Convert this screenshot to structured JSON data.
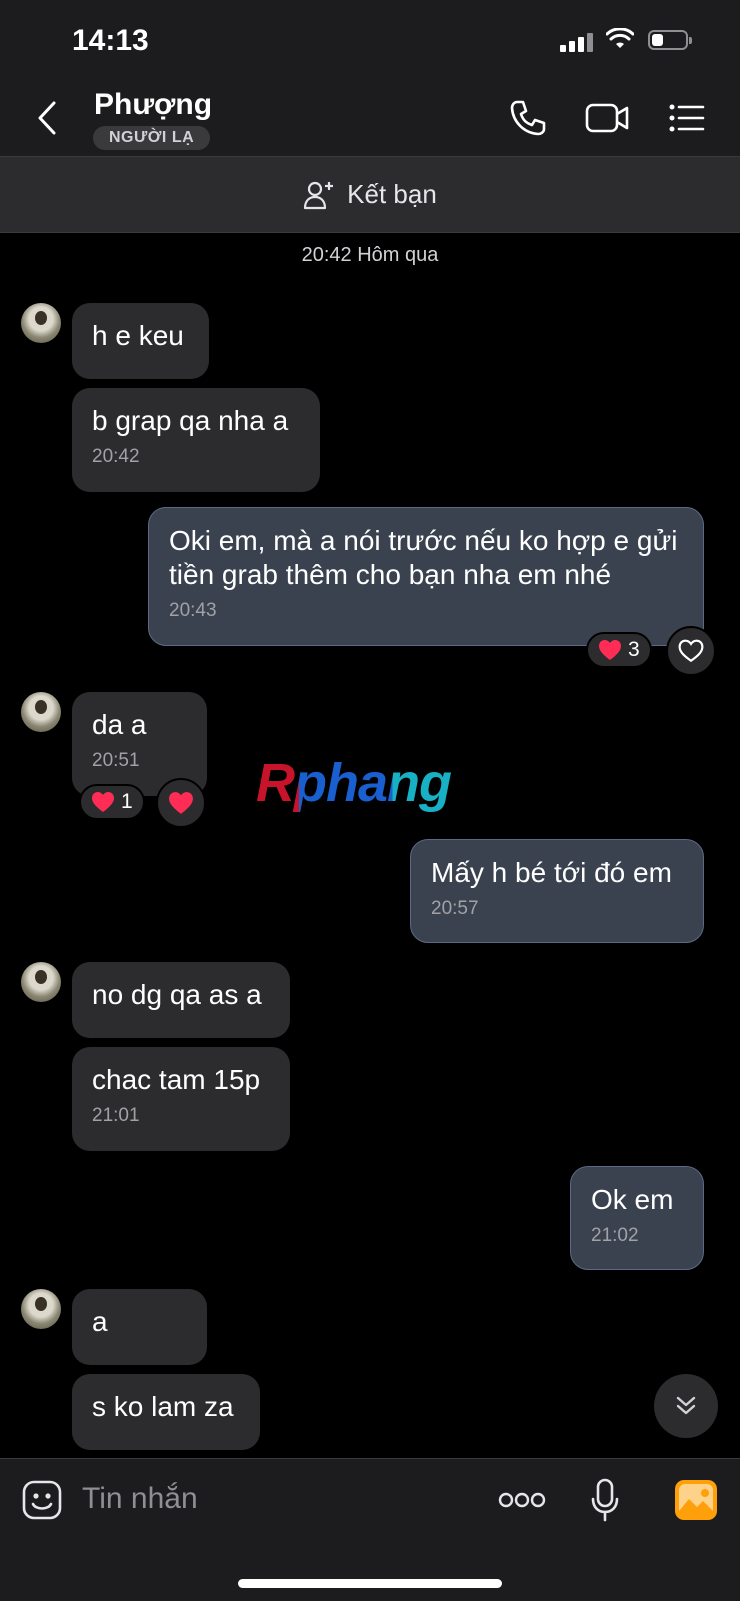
{
  "status": {
    "time": "14:13"
  },
  "header": {
    "contact_name": "Phượng",
    "badge": "NGƯỜI LẠ"
  },
  "add_friend": {
    "label": "Kết bạn"
  },
  "chat": {
    "date_divider": "20:42 Hôm qua",
    "messages": [
      {
        "side": "in",
        "text": "h e keu",
        "time": ""
      },
      {
        "side": "in",
        "text": "b grap qa nha a",
        "time": "20:42"
      },
      {
        "side": "out",
        "text": "Oki em, mà a nói trước nếu ko hợp e gửi tiền grab thêm cho bạn nha em nhé",
        "time": "20:43",
        "reaction_count": "3"
      },
      {
        "side": "in",
        "text": "da a",
        "time": "20:51",
        "reaction_count": "1"
      },
      {
        "side": "out",
        "text": "Mấy h bé tới đó em",
        "time": "20:57"
      },
      {
        "side": "in",
        "text": "no dg qa as a",
        "time": ""
      },
      {
        "side": "in",
        "text": "chac tam 15p",
        "time": "21:01"
      },
      {
        "side": "out",
        "text": "Ok em",
        "time": "21:02"
      },
      {
        "side": "in",
        "text": "a",
        "time": ""
      },
      {
        "side": "in",
        "text": "s ko lam za",
        "time": ""
      }
    ]
  },
  "watermark": {
    "text": "Rphang"
  },
  "input": {
    "placeholder": "Tin nhắn"
  },
  "icons": {
    "back": "chevron-left-icon",
    "call": "phone-icon",
    "video": "video-camera-icon",
    "menu": "list-icon",
    "add_friend": "add-person-icon",
    "sticker": "sticker-icon",
    "more": "more-dots-icon",
    "mic": "microphone-icon",
    "gallery": "image-icon",
    "heart": "heart-icon",
    "scroll": "double-chevron-down-icon"
  },
  "colors": {
    "accent_gallery": "#ff9f0a",
    "heart": "#ff2d55",
    "outgoing_bubble": "#3a4250",
    "incoming_bubble": "#2c2c2e"
  }
}
